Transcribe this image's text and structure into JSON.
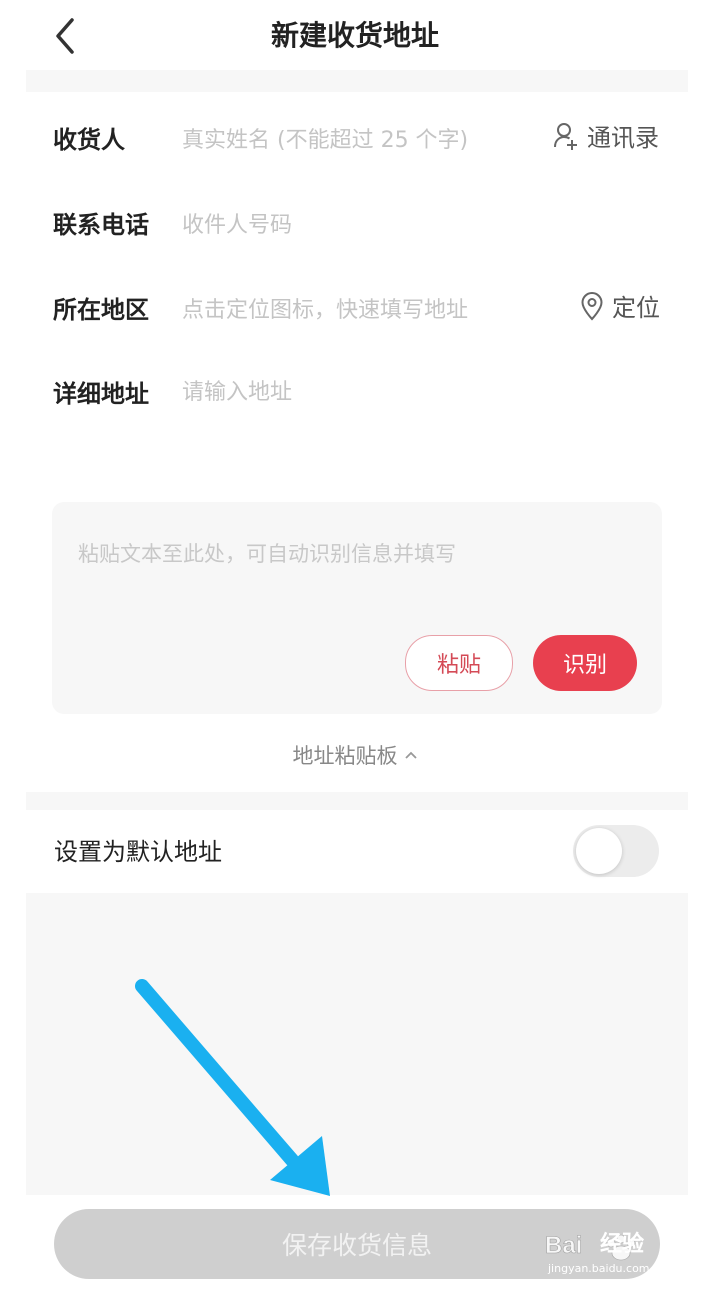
{
  "header": {
    "title": "新建收货地址",
    "back_icon": "chevron-left-icon"
  },
  "form": {
    "name": {
      "label": "收货人",
      "placeholder": "真实姓名 (不能超过 25 个字)",
      "action_label": "通讯录",
      "action_icon": "user-plus-icon"
    },
    "phone": {
      "label": "联系电话",
      "placeholder": "收件人号码"
    },
    "region": {
      "label": "所在地区",
      "placeholder": "点击定位图标，快速填写地址",
      "action_label": "定位",
      "action_icon": "location-pin-icon"
    },
    "detail": {
      "label": "详细地址",
      "placeholder": "请输入地址"
    }
  },
  "paste_board": {
    "placeholder": "粘贴文本至此处，可自动识别信息并填写",
    "paste_label": "粘贴",
    "recognize_label": "识别",
    "toggle_label": "地址粘贴板",
    "toggle_icon": "chevron-up-icon"
  },
  "default_address": {
    "label": "设置为默认地址",
    "enabled": false
  },
  "save": {
    "label": "保存收货信息"
  },
  "annotation": {
    "arrow_color": "#1ab0f0",
    "arrow_icon": "arrow-down-right-icon"
  },
  "watermark": {
    "brand": "Baidu 经验",
    "text": "经验",
    "url": "jingyan.baidu.com"
  },
  "colors": {
    "accent": "#e8404f",
    "placeholder": "#c4c4c4",
    "disabled_button": "#cfcfcf"
  }
}
